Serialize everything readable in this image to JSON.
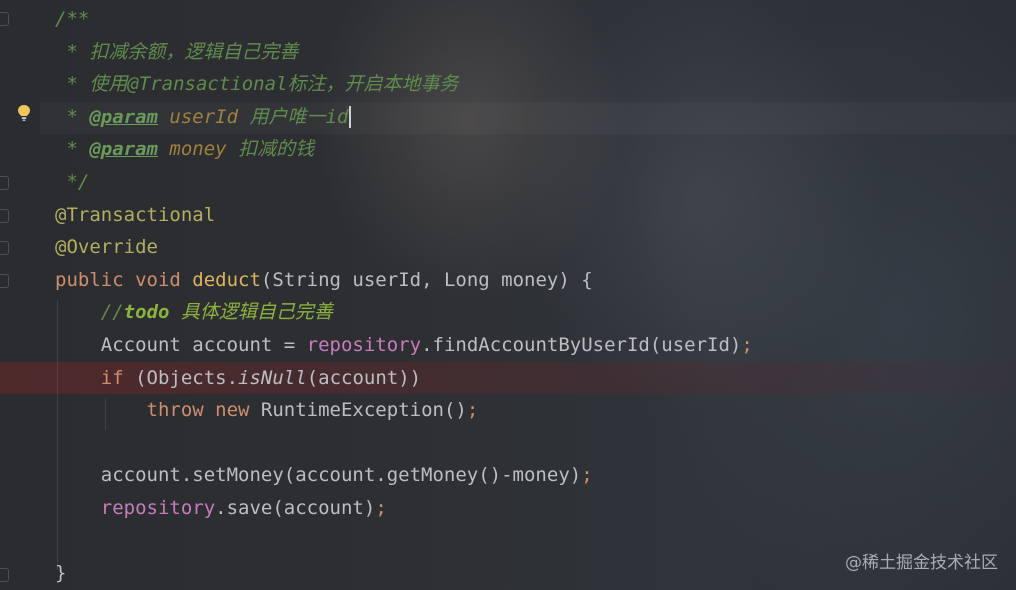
{
  "editor": {
    "lines": [
      [
        {
          "t": "/**",
          "c": "cm"
        }
      ],
      [
        {
          "t": " * 扣减余额，逻辑自己完善",
          "c": "cm"
        }
      ],
      [
        {
          "t": " * 使用@Transactional标注，开启本地事务",
          "c": "cm"
        }
      ],
      [
        {
          "t": " * ",
          "c": "cm"
        },
        {
          "t": "@param",
          "c": "tag"
        },
        {
          "t": " ",
          "c": "cm"
        },
        {
          "t": "userId",
          "c": "pname"
        },
        {
          "t": " 用户唯一id",
          "c": "cm"
        }
      ],
      [
        {
          "t": " * ",
          "c": "cm"
        },
        {
          "t": "@param",
          "c": "tag"
        },
        {
          "t": " ",
          "c": "cm"
        },
        {
          "t": "money",
          "c": "pname"
        },
        {
          "t": " 扣减的钱",
          "c": "cm"
        }
      ],
      [
        {
          "t": " */",
          "c": "cm"
        }
      ],
      [
        {
          "t": "@Transactional",
          "c": "ann"
        }
      ],
      [
        {
          "t": "@Override",
          "c": "ann"
        }
      ],
      [
        {
          "t": "public ",
          "c": "kw"
        },
        {
          "t": "void ",
          "c": "kw"
        },
        {
          "t": "deduct",
          "c": "fnd"
        },
        {
          "t": "(String userId, Long money) {",
          "c": ""
        }
      ],
      [
        {
          "t": "    //",
          "c": "cm"
        },
        {
          "t": "todo",
          "c": "todo"
        },
        {
          "t": " 具体逻辑自己完善",
          "c": "todotxt"
        }
      ],
      [
        {
          "t": "    Account account = ",
          "c": ""
        },
        {
          "t": "repository",
          "c": "field"
        },
        {
          "t": ".findAccountByUserId(userId)",
          "c": ""
        },
        {
          "t": ";",
          "c": "semi"
        }
      ],
      [
        {
          "t": "    ",
          "c": ""
        },
        {
          "t": "if ",
          "c": "kw"
        },
        {
          "t": "(Objects.",
          "c": ""
        },
        {
          "t": "isNull",
          "c": "it"
        },
        {
          "t": "(account))",
          "c": ""
        }
      ],
      [
        {
          "t": "        ",
          "c": ""
        },
        {
          "t": "throw ",
          "c": "kw"
        },
        {
          "t": "new ",
          "c": "kw"
        },
        {
          "t": "RuntimeException()",
          "c": ""
        },
        {
          "t": ";",
          "c": "semi"
        }
      ],
      [
        {
          "t": "",
          "c": ""
        }
      ],
      [
        {
          "t": "    account.setMoney(account.getMoney()-money)",
          "c": ""
        },
        {
          "t": ";",
          "c": "semi"
        }
      ],
      [
        {
          "t": "    ",
          "c": ""
        },
        {
          "t": "repository",
          "c": "field"
        },
        {
          "t": ".save(account)",
          "c": ""
        },
        {
          "t": ";",
          "c": "semi"
        }
      ],
      [
        {
          "t": "",
          "c": ""
        }
      ],
      [
        {
          "t": "}",
          "c": ""
        }
      ]
    ],
    "caret_line": 3,
    "current_line": 3,
    "error_line": 11,
    "gutter_icons": [
      "intention-bulb-icon"
    ]
  },
  "watermark": "@稀土掘金技术社区",
  "colors": {
    "background": "#2b2d30",
    "comment": "#5f8c4d",
    "keyword": "#cf8e6d",
    "annotation": "#b3ae60",
    "method_declaration": "#e0b35e",
    "field": "#c77dbb",
    "todo": "#8bb33d",
    "error_highlight": "#6e2828"
  }
}
